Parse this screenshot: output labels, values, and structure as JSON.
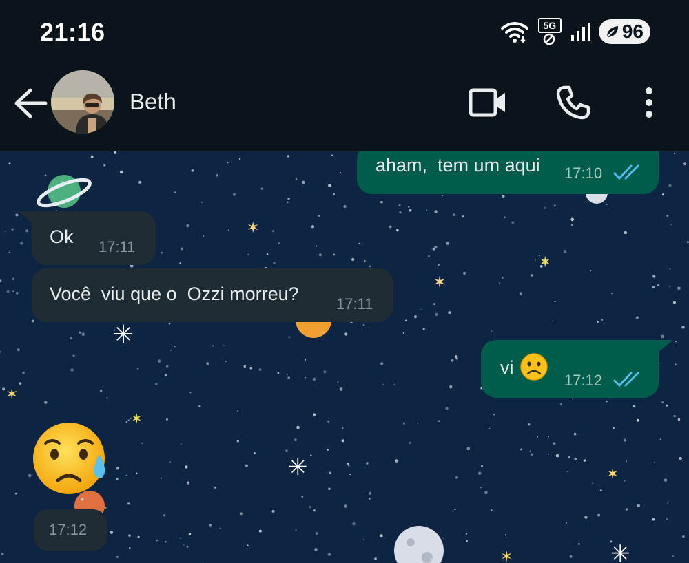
{
  "status_bar": {
    "time": "21:16",
    "network_label": "5G",
    "battery": "96"
  },
  "header": {
    "contact_name": "Beth"
  },
  "messages": [
    {
      "direction": "out",
      "text": "aham,  tem um aqui",
      "time": "17:10",
      "status": "read"
    },
    {
      "direction": "in",
      "text": "Ok",
      "time": "17:11"
    },
    {
      "direction": "in",
      "text": "Você  viu que o  Ozzi morreu?",
      "time": "17:11"
    },
    {
      "direction": "out",
      "text": "vi",
      "emoji": "frowning-face",
      "time": "17:12",
      "status": "read"
    },
    {
      "direction": "in",
      "emoji": "sad-but-relieved-face",
      "time": "17:12"
    }
  ],
  "colors": {
    "app_bar": "#0b141a",
    "wallpaper": "#0e2443",
    "incoming_bubble": "#202c33",
    "outgoing_bubble": "#005c4b",
    "read_ticks": "#53bdeb"
  }
}
